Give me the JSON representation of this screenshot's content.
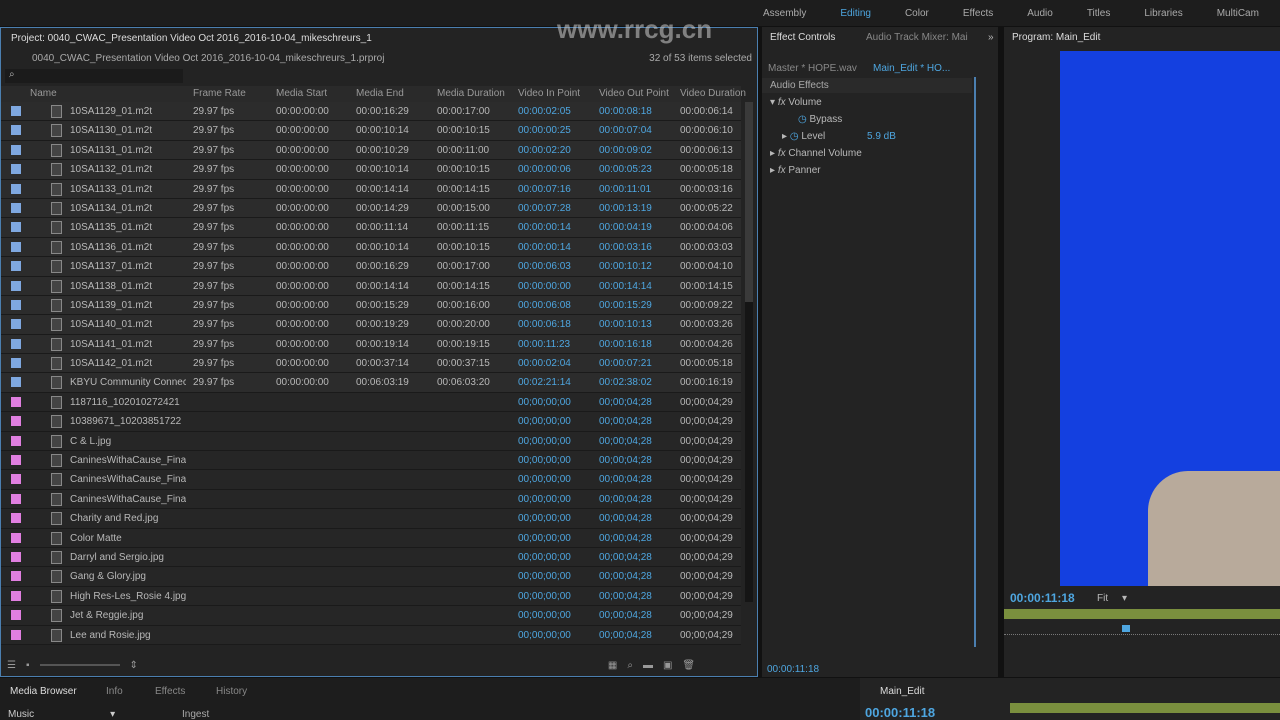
{
  "workspaces": [
    {
      "label": "Assembly"
    },
    {
      "label": "Editing",
      "active": true
    },
    {
      "label": "Color"
    },
    {
      "label": "Effects"
    },
    {
      "label": "Audio"
    },
    {
      "label": "Titles"
    },
    {
      "label": "Libraries"
    },
    {
      "label": "MultiCam"
    }
  ],
  "project": {
    "title": "Project: 0040_CWAC_Presentation Video Oct 2016_2016-10-04_mikeschreurs_1",
    "file": "0040_CWAC_Presentation Video Oct 2016_2016-10-04_mikeschreurs_1.prproj",
    "selected": "32 of 53 items selected",
    "columns": [
      "Name",
      "Frame Rate",
      "Media Start",
      "Media End",
      "Media Duration",
      "Video In Point",
      "Video Out Point",
      "Video Duration"
    ],
    "colors": {
      "video": "#7fa8e0",
      "still": "#e07fe0"
    },
    "rows": [
      [
        "10SA1129_01.m2t",
        "29.97 fps",
        "00:00:00:00",
        "00:00:16:29",
        "00:00:17:00",
        "00:00:02:05",
        "00:00:08:18",
        "00:00:06:14"
      ],
      [
        "10SA1130_01.m2t",
        "29.97 fps",
        "00:00:00:00",
        "00:00:10:14",
        "00:00:10:15",
        "00:00:00:25",
        "00:00:07:04",
        "00:00:06:10"
      ],
      [
        "10SA1131_01.m2t",
        "29.97 fps",
        "00:00:00:00",
        "00:00:10:29",
        "00:00:11:00",
        "00:00:02:20",
        "00:00:09:02",
        "00:00:06:13"
      ],
      [
        "10SA1132_01.m2t",
        "29.97 fps",
        "00:00:00:00",
        "00:00:10:14",
        "00:00:10:15",
        "00:00:00:06",
        "00:00:05:23",
        "00:00:05:18"
      ],
      [
        "10SA1133_01.m2t",
        "29.97 fps",
        "00:00:00:00",
        "00:00:14:14",
        "00:00:14:15",
        "00:00:07:16",
        "00:00:11:01",
        "00:00:03:16"
      ],
      [
        "10SA1134_01.m2t",
        "29.97 fps",
        "00:00:00:00",
        "00:00:14:29",
        "00:00:15:00",
        "00:00:07:28",
        "00:00:13:19",
        "00:00:05:22"
      ],
      [
        "10SA1135_01.m2t",
        "29.97 fps",
        "00:00:00:00",
        "00:00:11:14",
        "00:00:11:15",
        "00:00:00:14",
        "00:00:04:19",
        "00:00:04:06"
      ],
      [
        "10SA1136_01.m2t",
        "29.97 fps",
        "00:00:00:00",
        "00:00:10:14",
        "00:00:10:15",
        "00:00:00:14",
        "00:00:03:16",
        "00:00:03:03"
      ],
      [
        "10SA1137_01.m2t",
        "29.97 fps",
        "00:00:00:00",
        "00:00:16:29",
        "00:00:17:00",
        "00:00:06:03",
        "00:00:10:12",
        "00:00:04:10"
      ],
      [
        "10SA1138_01.m2t",
        "29.97 fps",
        "00:00:00:00",
        "00:00:14:14",
        "00:00:14:15",
        "00:00:00:00",
        "00:00:14:14",
        "00:00:14:15"
      ],
      [
        "10SA1139_01.m2t",
        "29.97 fps",
        "00:00:00:00",
        "00:00:15:29",
        "00:00:16:00",
        "00:00:06:08",
        "00:00:15:29",
        "00:00:09:22"
      ],
      [
        "10SA1140_01.m2t",
        "29.97 fps",
        "00:00:00:00",
        "00:00:19:29",
        "00:00:20:00",
        "00:00:06:18",
        "00:00:10:13",
        "00:00:03:26"
      ],
      [
        "10SA1141_01.m2t",
        "29.97 fps",
        "00:00:00:00",
        "00:00:19:14",
        "00:00:19:15",
        "00:00:11:23",
        "00:00:16:18",
        "00:00:04:26"
      ],
      [
        "10SA1142_01.m2t",
        "29.97 fps",
        "00:00:00:00",
        "00:00:37:14",
        "00:00:37:15",
        "00:00:02:04",
        "00:00:07:21",
        "00:00:05:18"
      ],
      [
        "KBYU Community Connect",
        "29.97 fps",
        "00:00:00:00",
        "00:06:03:19",
        "00:06:03:20",
        "00:02:21:14",
        "00:02:38:02",
        "00:00:16:19"
      ],
      [
        "1187116_102010272421",
        "",
        "",
        "",
        "",
        "00;00;00;00",
        "00;00;04;28",
        "00;00;04;29"
      ],
      [
        "10389671_10203851722",
        "",
        "",
        "",
        "",
        "00;00;00;00",
        "00;00;04;28",
        "00;00;04;29"
      ],
      [
        "C & L.jpg",
        "",
        "",
        "",
        "",
        "00;00;00;00",
        "00;00;04;28",
        "00;00;04;29"
      ],
      [
        "CaninesWithaCause_Final",
        "",
        "",
        "",
        "",
        "00;00;00;00",
        "00;00;04;28",
        "00;00;04;29"
      ],
      [
        "CaninesWithaCause_Final",
        "",
        "",
        "",
        "",
        "00;00;00;00",
        "00;00;04;28",
        "00;00;04;29"
      ],
      [
        "CaninesWithaCause_Final.",
        "",
        "",
        "",
        "",
        "00;00;00;00",
        "00;00;04;28",
        "00;00;04;29"
      ],
      [
        "Charity and Red.jpg",
        "",
        "",
        "",
        "",
        "00;00;00;00",
        "00;00;04;28",
        "00;00;04;29"
      ],
      [
        "Color Matte",
        "",
        "",
        "",
        "",
        "00;00;00;00",
        "00;00;04;28",
        "00;00;04;29"
      ],
      [
        "Darryl and Sergio.jpg",
        "",
        "",
        "",
        "",
        "00;00;00;00",
        "00;00;04;28",
        "00;00;04;29"
      ],
      [
        "Gang & Glory.jpg",
        "",
        "",
        "",
        "",
        "00;00;00;00",
        "00;00;04;28",
        "00;00;04;29"
      ],
      [
        "High Res-Les_Rosie 4.jpg",
        "",
        "",
        "",
        "",
        "00;00;00;00",
        "00;00;04;28",
        "00;00;04;29"
      ],
      [
        "Jet & Reggie.jpg",
        "",
        "",
        "",
        "",
        "00;00;00;00",
        "00;00;04;28",
        "00;00;04;29"
      ],
      [
        "Lee and Rosie.jpg",
        "",
        "",
        "",
        "",
        "00;00;00;00",
        "00;00;04;28",
        "00;00;04;29"
      ]
    ]
  },
  "effect_controls": {
    "tab": "Effect Controls",
    "tab2": "Audio Track Mixer: Mai",
    "master": "Master * HOPE.wav",
    "clip": "Main_Edit * HO...",
    "section": "Audio Effects",
    "volume": "Volume",
    "bypass": "Bypass",
    "level": "Level",
    "level_value": "5.9 dB",
    "channel_volume": "Channel Volume",
    "panner": "Panner",
    "timecode": "00:00:11:18"
  },
  "program": {
    "title": "Program: Main_Edit",
    "timecode": "00:00:11:18",
    "fit": "Fit"
  },
  "bottom": {
    "tabs": [
      "Media Browser",
      "Info",
      "Effects",
      "History"
    ],
    "dropdown": "Music",
    "ingest": "Ingest",
    "timeline_tab": "Main_Edit",
    "timeline_timecode": "00:00:11:18"
  },
  "watermark": "www.rrcg.cn"
}
